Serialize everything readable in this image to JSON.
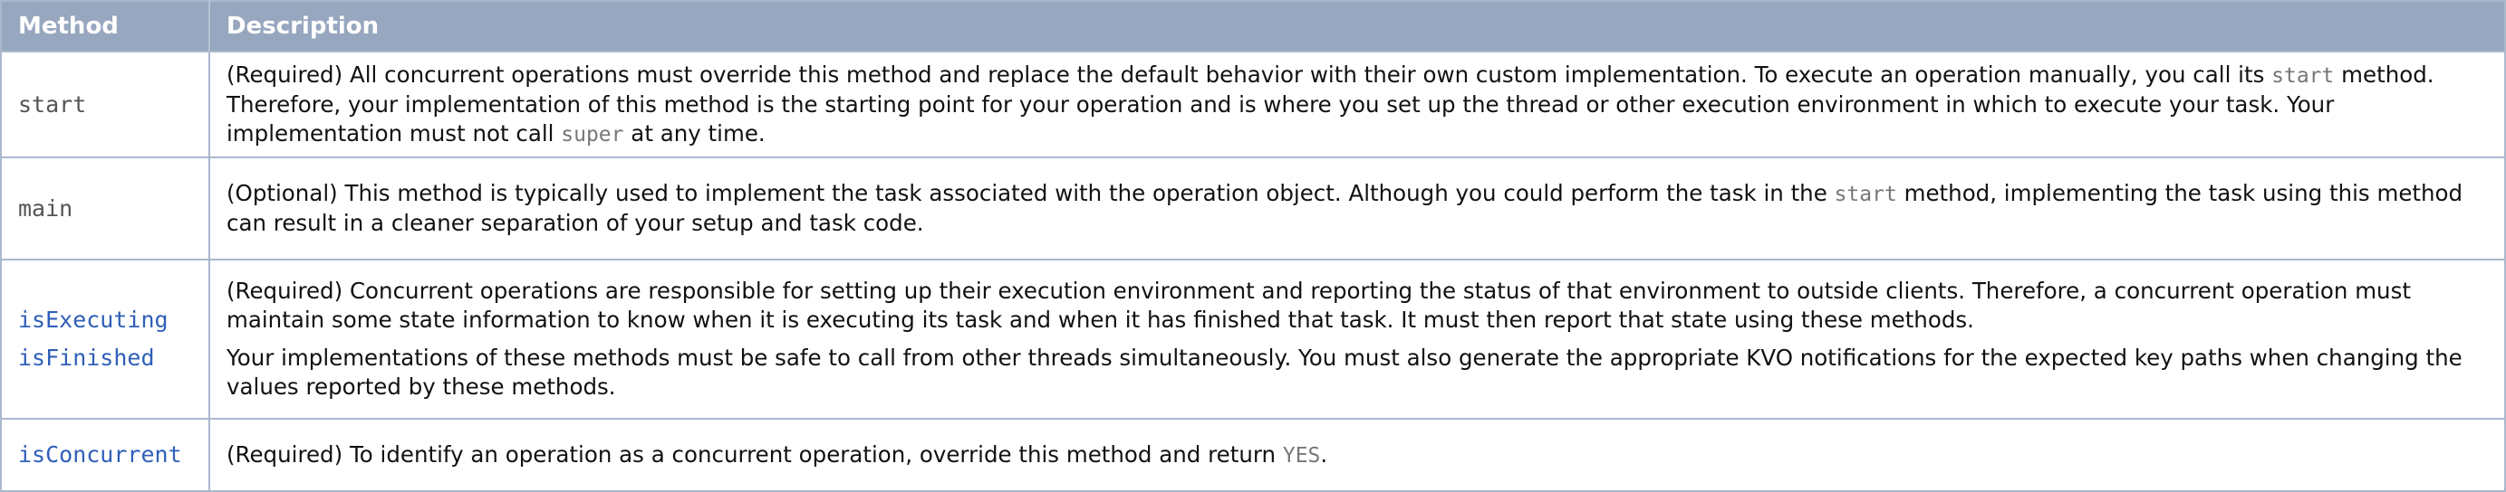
{
  "table": {
    "headers": {
      "method": "Method",
      "description": "Description"
    },
    "rows": [
      {
        "methods": [
          "start"
        ],
        "description": [
          [
            "(Required) All concurrent operations must override this method and replace the default behavior with their own custom implementation. To execute an operation manually, you call its ",
            "start",
            " method. Therefore, your implementation of this method is the starting point for your operation and is where you set up the thread or other execution environment in which to execute your task. Your implementation must not call ",
            "super",
            " at any time."
          ]
        ]
      },
      {
        "methods": [
          "main"
        ],
        "description": [
          [
            "(Optional) This method is typically used to implement the task associated with the operation object. Although you could perform the task in the ",
            "start",
            " method, implementing the task using this method can result in a cleaner separation of your setup and task code."
          ]
        ]
      },
      {
        "methods": [
          "isExecuting",
          "isFinished"
        ],
        "description": [
          [
            "(Required) Concurrent operations are responsible for setting up their execution environment and reporting the status of that environment to outside clients. Therefore, a concurrent operation must maintain some state information to know when it is executing its task and when it has finished that task. It must then report that state using these methods."
          ],
          [
            "Your implementations of these methods must be safe to call from other threads simultaneously. You must also generate the appropriate KVO notifications for the expected key paths when changing the values reported by these methods."
          ]
        ]
      },
      {
        "methods": [
          "isConcurrent"
        ],
        "description": [
          [
            "(Required) To identify an operation as a concurrent operation, override this method and return ",
            "YES",
            "."
          ]
        ]
      }
    ]
  }
}
